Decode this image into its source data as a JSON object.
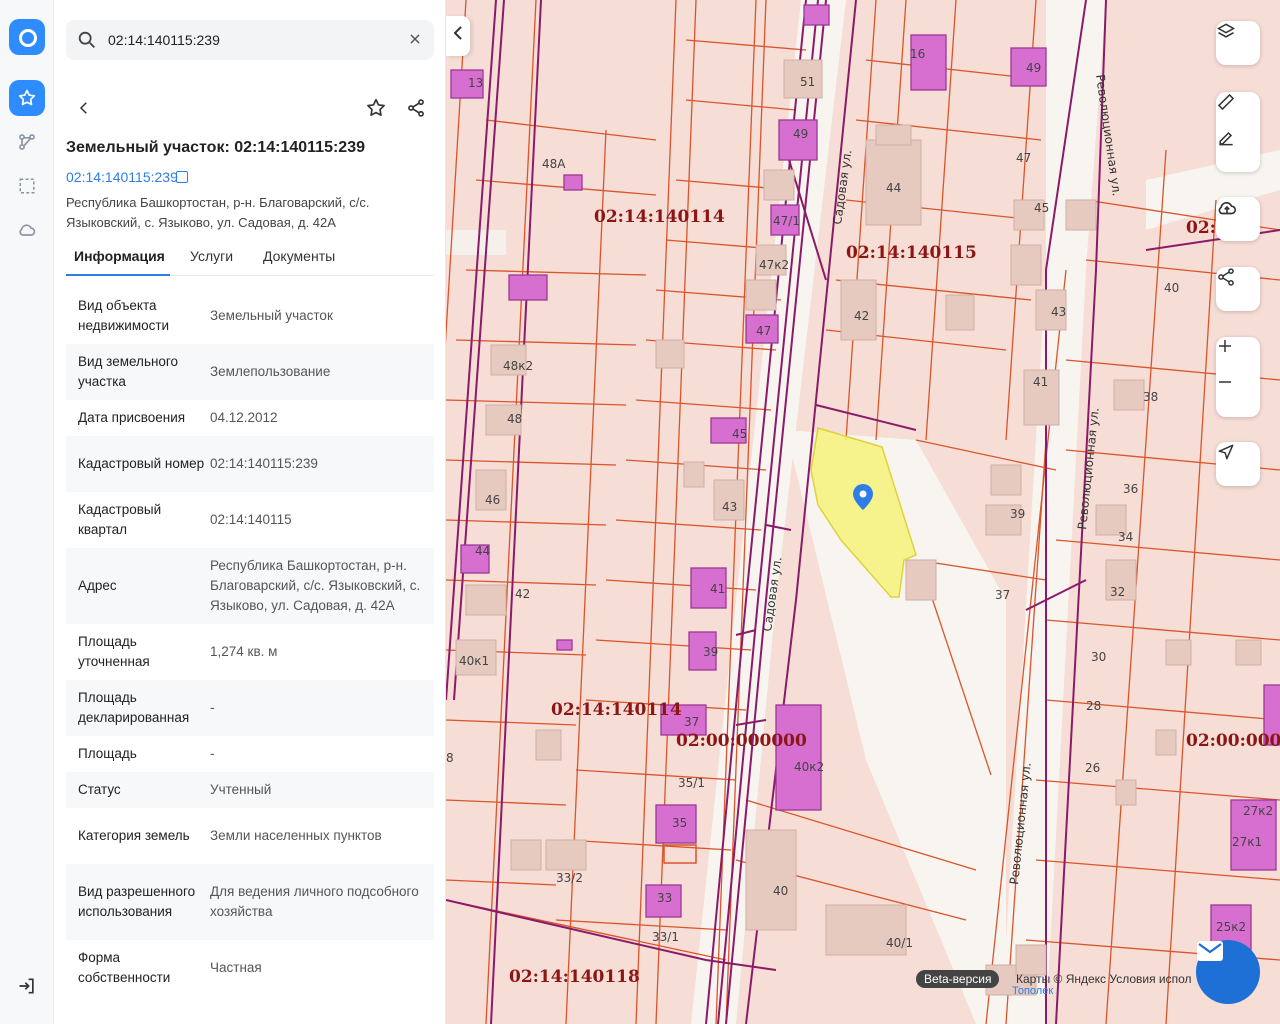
{
  "search": {
    "value": "02:14:140115:239"
  },
  "object": {
    "title": "Земельный участок: 02:14:140115:239",
    "cad_number": "02:14:140115:239",
    "address": "Республика Башкортостан, р-н. Благоварский, с/с. Языковский, с. Языково, ул. Садовая, д. 42А"
  },
  "tabs": [
    {
      "label": "Информация"
    },
    {
      "label": "Услуги"
    },
    {
      "label": "Документы"
    }
  ],
  "info_rows": [
    {
      "key": "Вид объекта недвижимости",
      "value": "Земельный участок"
    },
    {
      "key": "Вид земельного участка",
      "value": "Землепользование"
    },
    {
      "key": "Дата присвоения",
      "value": "04.12.2012"
    },
    {
      "key": "Кадастровый номер",
      "value": "02:14:140115:239"
    },
    {
      "key": "Кадастровый квартал",
      "value": "02:14:140115"
    },
    {
      "key": "Адрес",
      "value": "Республика Башкортостан, р-н. Благоварский, с/с. Языковский, с. Языково, ул. Садовая, д. 42А"
    },
    {
      "key": "Площадь уточненная",
      "value": "1,274 кв. м"
    },
    {
      "key": "Площадь декларированная",
      "value": "-"
    },
    {
      "key": "Площадь",
      "value": "-"
    },
    {
      "key": "Статус",
      "value": "Учтенный"
    },
    {
      "key": "Категория земель",
      "value": "Земли населенных пунктов"
    },
    {
      "key": "Вид разрешенного использования",
      "value": "Для ведения личного подсобного хозяйства"
    },
    {
      "key": "Форма собственности",
      "value": "Частная"
    }
  ],
  "map": {
    "quarter_labels": [
      "02:14:140114",
      "02:14:140115",
      "02:14:140114",
      "02:00:000000",
      "02:00:000000",
      "02:14:140118",
      "02:"
    ],
    "street_labels": [
      "Садовая ул.",
      "Революционная ул.",
      "Садовая ул.",
      "Революционная ул.",
      "Революционная ул."
    ],
    "house_numbers": [
      "51",
      "49",
      "16",
      "49",
      "13",
      "48А",
      "47",
      "44",
      "47/1",
      "45",
      "47к2",
      "40",
      "42",
      "43",
      "47",
      "48к2",
      "41",
      "38",
      "48",
      "45",
      "39",
      "36",
      "46",
      "43",
      "34",
      "44",
      "41",
      "37",
      "32",
      "42",
      "39",
      "30",
      "40к1",
      "37",
      "28",
      "40к2",
      "26",
      "35/1",
      "35",
      "33/2",
      "40",
      "33",
      "33/1",
      "40/1",
      "25к2",
      "27к2",
      "27к1",
      "8"
    ],
    "beta": "Beta-версия",
    "attribution": "Карты © Яндекс   Условия испол",
    "topolek": "Тополек"
  },
  "colors": {
    "accent": "#2f8cff",
    "link": "#2f7ee8",
    "parcel_fill": "#f6ddd5",
    "parcel_line": "#d9552b",
    "building": "#d76fd0",
    "selected": "#f7f27a",
    "quarter_line": "#8c1a6a"
  }
}
